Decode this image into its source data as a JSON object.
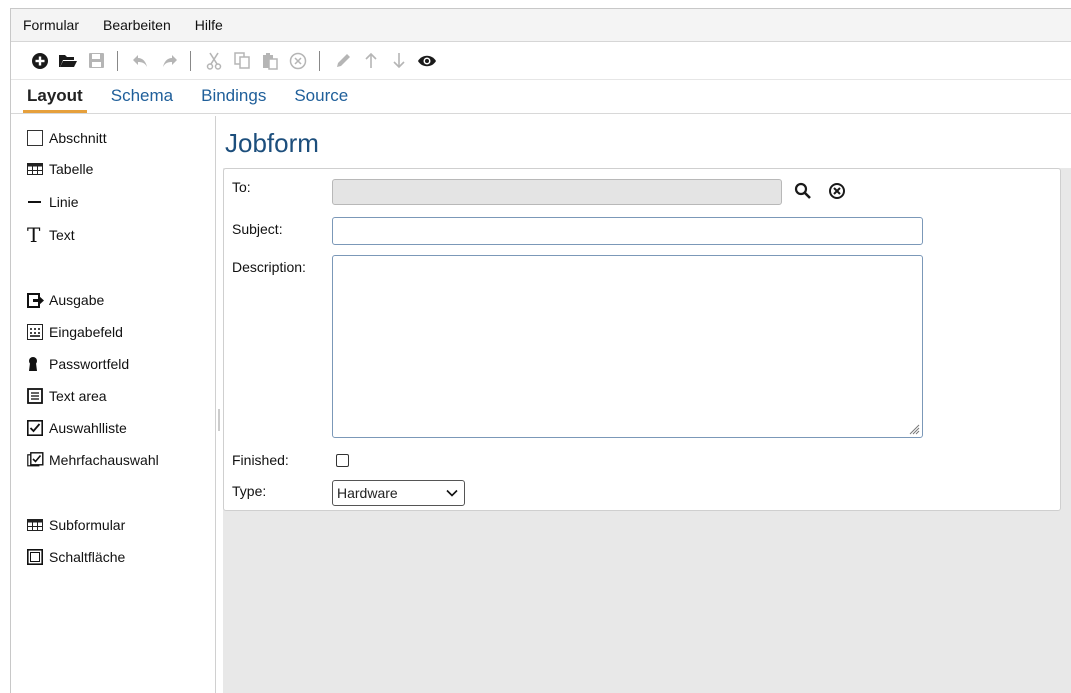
{
  "menu": [
    "Formular",
    "Bearbeiten",
    "Hilfe"
  ],
  "toolbar": {
    "icons": [
      "plus-circle-icon",
      "folder-open-icon",
      "save-icon",
      "undo-icon",
      "redo-icon",
      "cut-icon",
      "copy-icon",
      "paste-icon",
      "delete-icon",
      "edit-icon",
      "move-up-icon",
      "move-down-icon",
      "preview-eye-icon"
    ],
    "active_color": "#1a1a1a",
    "disabled_color": "#b5b5b5"
  },
  "tabs": [
    "Layout",
    "Schema",
    "Bindings",
    "Source"
  ],
  "active_tab": "Layout",
  "palette": {
    "group1": [
      "Abschnitt",
      "Tabelle",
      "Linie",
      "Text"
    ],
    "group2": [
      "Ausgabe",
      "Eingabefeld",
      "Passwortfeld",
      "Text area",
      "Auswahlliste",
      "Mehrfachauswahl"
    ],
    "group3": [
      "Subformular",
      "Schaltfläche"
    ]
  },
  "form": {
    "title": "Jobform",
    "fields": {
      "to_label": "To:",
      "to_value": "",
      "subject_label": "Subject:",
      "subject_value": "",
      "description_label": "Description:",
      "description_value": "",
      "finished_label": "Finished:",
      "finished_checked": false,
      "type_label": "Type:",
      "type_value": "Hardware"
    }
  },
  "colors": {
    "accent_tab_underline": "#e6a03c",
    "link_blue": "#1f5f9a",
    "title_blue": "#1c4e7c",
    "canvas_grey": "#e8e8e8"
  }
}
